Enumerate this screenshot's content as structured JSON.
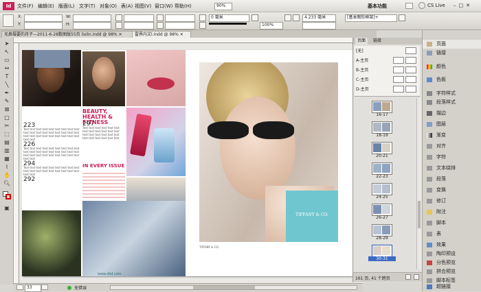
{
  "menubar": {
    "logo": "Id",
    "menus": [
      "文件(F)",
      "编辑(E)",
      "版面(L)",
      "文字(T)",
      "对象(O)",
      "表(A)",
      "视图(V)",
      "窗口(W)",
      "帮助(H)"
    ],
    "zoom": "90%",
    "workspace": "基本功能",
    "cs_live": "CS Live"
  },
  "control": {
    "x_label": "X:",
    "y_label": "Y:",
    "w_label": "W:",
    "h_label": "H:",
    "stroke_value": "0 毫米",
    "percent_value": "100%",
    "measure_value": "4.233 毫米",
    "frame_style": "[基本图形框架]+"
  },
  "doctabs": [
    {
      "label": "无鼻摄要的月子—2011-6-28数图版55页 lixlin.indd @ 98% ✕",
      "active": false
    },
    {
      "label": "雷界内文l.indd @ 98% ✕",
      "active": true
    }
  ],
  "spread": {
    "left_page": {
      "headline": "BEAUTY, HEALTH & FITNESS",
      "headline2": "IN EVERY ISSUE",
      "page_numbers": [
        "223",
        "226",
        "297",
        "294",
        "292"
      ],
      "watermark": "www.zbd.com"
    },
    "right_page": {
      "brand": "TIFFANY & CO.",
      "caption": "TIFFANY & CO."
    }
  },
  "pages_panel": {
    "tabs": [
      "页面",
      "链接"
    ],
    "masters": [
      "[无]",
      "A-主页",
      "B-主页",
      "C-主页",
      "D-主页"
    ],
    "spreads": [
      "16-17",
      "18-19",
      "20-21",
      "22-23",
      "24-25",
      "26-27",
      "28-29",
      "30-31"
    ],
    "footer": "161 页, 41 个跨页"
  },
  "right_panel": {
    "items": [
      "页面",
      "链接",
      "颜色",
      "色板",
      "字符样式",
      "段落样式",
      "描边",
      "图层",
      "渐变",
      "对齐",
      "字符",
      "文本绕排",
      "段落",
      "变换",
      "修订",
      "附注",
      "脚本",
      "表",
      "效果",
      "陶印预设",
      "分色预览",
      "拼合预览",
      "脚本标签",
      "超链接"
    ]
  },
  "status": {
    "page": "33",
    "errors": "无错误"
  },
  "colors": {
    "accent": "#c8205a",
    "tiffany": "#6fc6cf"
  }
}
